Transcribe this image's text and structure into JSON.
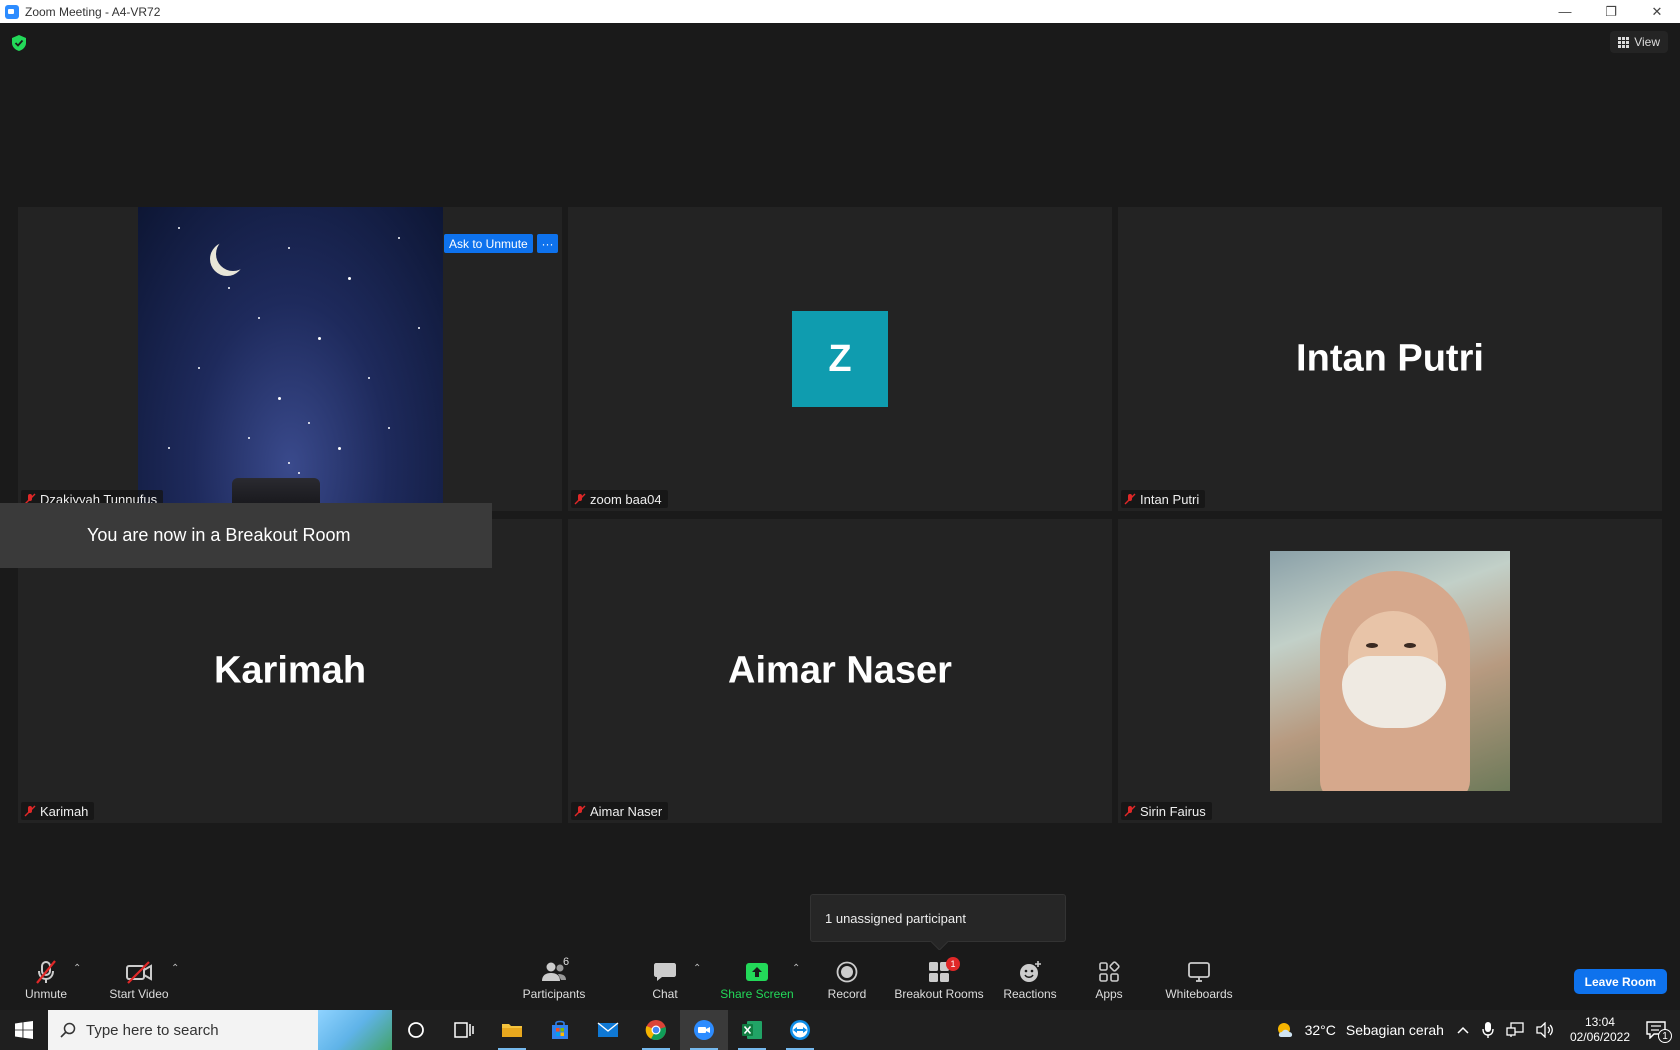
{
  "window": {
    "title": "Zoom Meeting - A4-VR72",
    "minimize": "—",
    "restore": "❐",
    "close": "✕"
  },
  "header": {
    "view_label": "View",
    "shield_icon": "shield-check-icon",
    "shield_color": "#23d959"
  },
  "tiles": [
    {
      "id": "t1",
      "display_name": "",
      "label": "Dzakiyyah Tunnufus",
      "media": "night-sky-image",
      "muted": true
    },
    {
      "id": "t2",
      "display_name": "Z",
      "label": "zoom baa04",
      "media": "avatar-letter",
      "muted": true
    },
    {
      "id": "t3",
      "display_name": "Intan Putri",
      "label": "Intan Putri",
      "media": "name-only",
      "muted": true
    },
    {
      "id": "t4",
      "display_name": "Karimah",
      "label": "Karimah",
      "media": "name-only",
      "muted": true
    },
    {
      "id": "t5",
      "display_name": "Aimar Naser",
      "label": "Aimar Naser",
      "media": "name-only",
      "muted": true
    },
    {
      "id": "t6",
      "display_name": "",
      "label": "Sirin Fairus",
      "media": "profile-photo",
      "muted": true
    }
  ],
  "tile_actions": {
    "ask_to_unmute": "Ask to Unmute",
    "more": "···"
  },
  "notification": {
    "breakout_message": "You are now in a Breakout Room"
  },
  "tooltip": {
    "text": "1 unassigned participant"
  },
  "toolbar": {
    "unmute": "Unmute",
    "start_video": "Start Video",
    "participants": "Participants",
    "participants_count": "6",
    "chat": "Chat",
    "share_screen": "Share Screen",
    "record": "Record",
    "breakout_rooms": "Breakout Rooms",
    "breakout_badge": "1",
    "reactions": "Reactions",
    "apps": "Apps",
    "whiteboards": "Whiteboards",
    "leave_room": "Leave Room",
    "caret": "⌃"
  },
  "taskbar": {
    "search_placeholder": "Type here to search",
    "weather_temp": "32°C",
    "weather_text": "Sebagian cerah",
    "time": "13:04",
    "date": "02/06/2022",
    "notification_count": "1",
    "apps": [
      "cortana-icon",
      "task-view-icon",
      "file-explorer-icon",
      "store-icon",
      "mail-icon",
      "chrome-icon",
      "zoom-icon",
      "excel-icon",
      "teamviewer-icon"
    ]
  },
  "colors": {
    "accent_blue": "#0e72ed",
    "share_green": "#23d959",
    "muted_red": "#e02828",
    "avatar_teal": "#0f9caf"
  }
}
